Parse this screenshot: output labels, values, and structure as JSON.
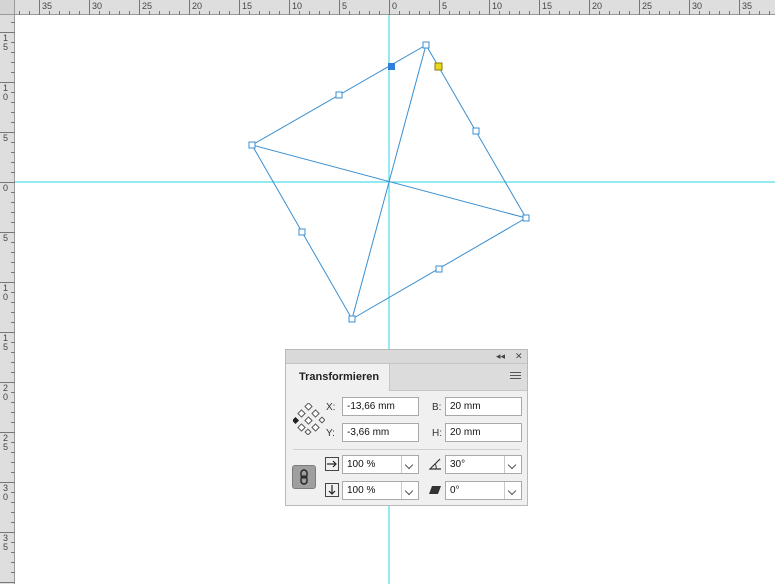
{
  "ruler": {
    "top_labels": [
      "35",
      "30",
      "25",
      "20",
      "15",
      "10",
      "5",
      "0",
      "5",
      "10",
      "15",
      "20",
      "25",
      "30",
      "35"
    ],
    "left_labels": [
      "1\n5",
      "1\n0",
      "5",
      "0",
      "5",
      "1\n0",
      "1\n5",
      "2\n0",
      "2\n5",
      "3\n0",
      "3\n5"
    ]
  },
  "colors": {
    "guide": "#2ad4e0",
    "path": "#3a8fd0",
    "handle_fill": "#ffffff",
    "selected_handle": "#2f7fdc",
    "rotate_handle": "#e8d81e"
  },
  "panel": {
    "collapse_label": "◂◂",
    "close_label": "✕",
    "tab_title": "Transformieren",
    "x_label": "X:",
    "x_value": "-13,66 mm",
    "y_label": "Y:",
    "y_value": "-3,66 mm",
    "w_label": "B:",
    "w_value": "20 mm",
    "h_label": "H:",
    "h_value": "20 mm",
    "scale_x_value": "100 %",
    "scale_y_value": "100 %",
    "rotation_value": "30°",
    "shear_value": "0°"
  }
}
